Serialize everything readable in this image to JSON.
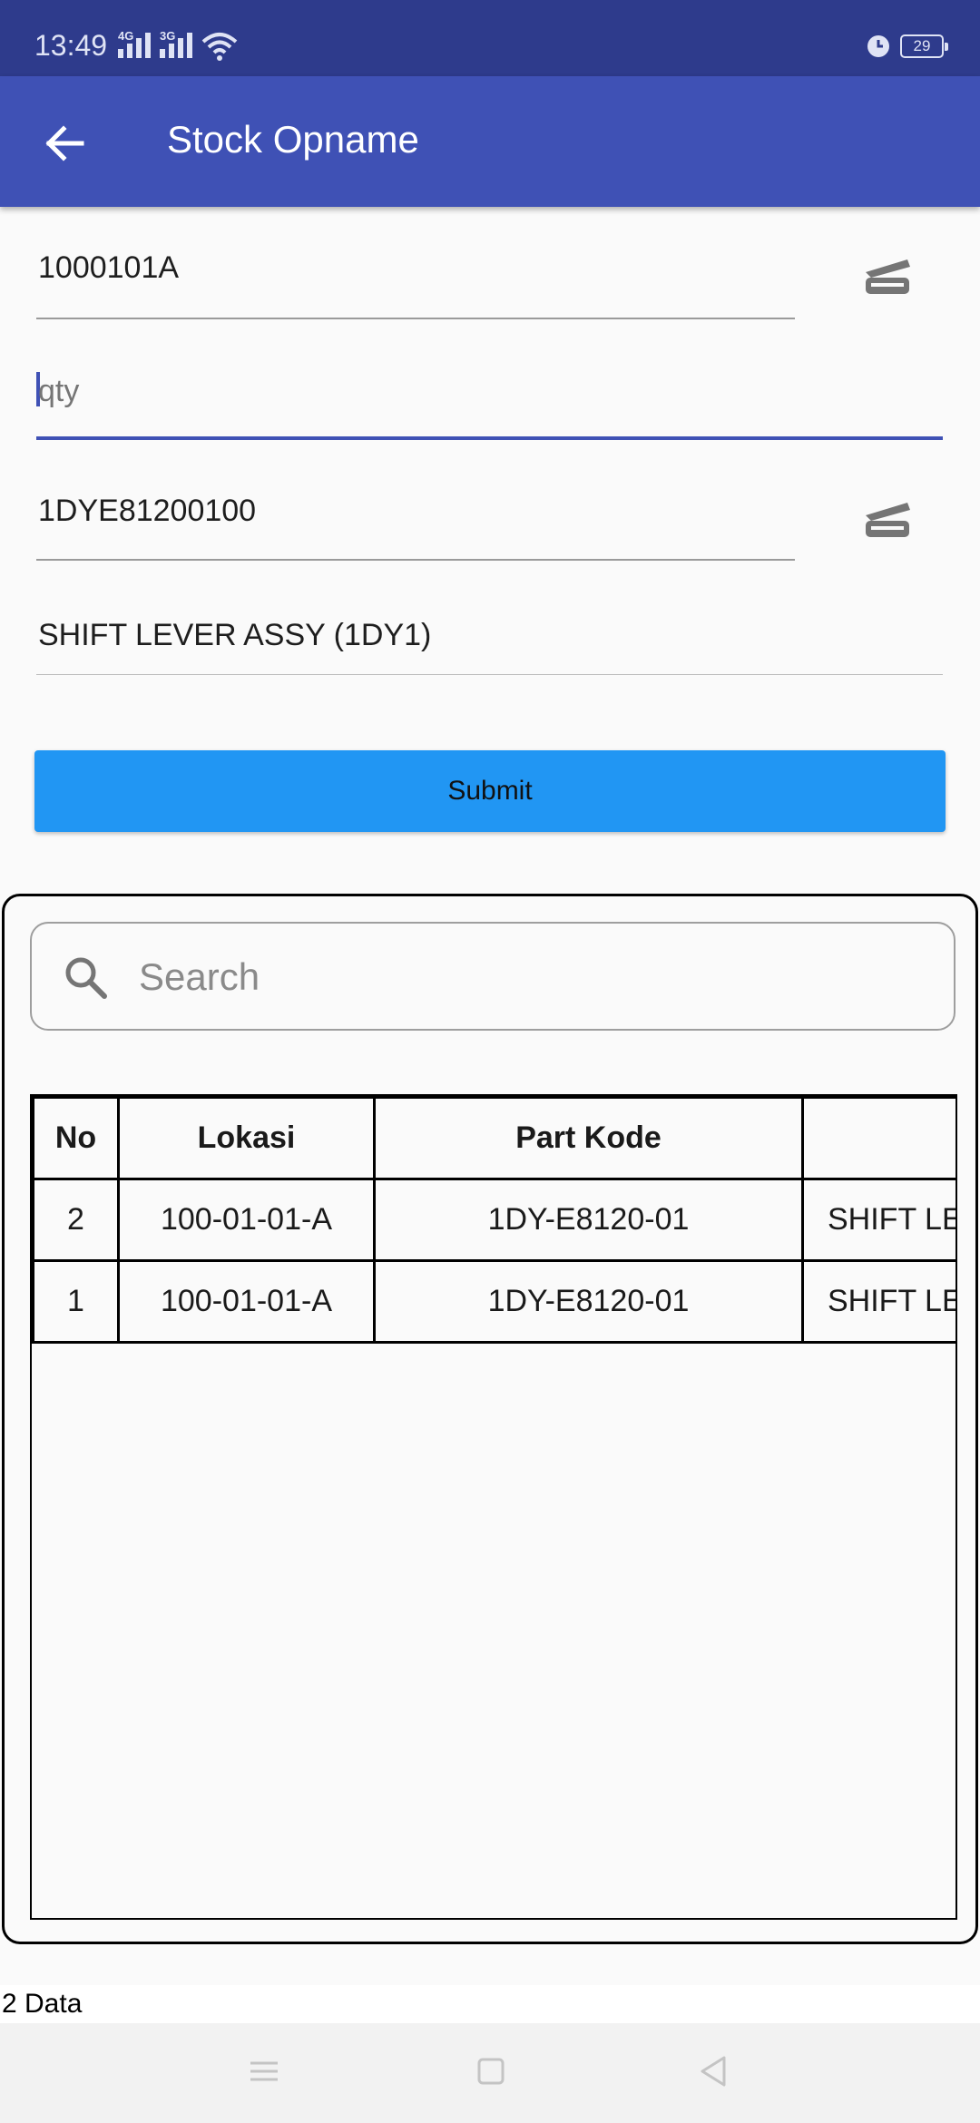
{
  "status_bar": {
    "time": "13:49",
    "network1": "4G",
    "network2": "3G",
    "battery": "29"
  },
  "app_bar": {
    "title": "Stock Opname"
  },
  "form": {
    "location_value": "1000101A",
    "qty_placeholder": "qty",
    "part_value": "1DYE81200100",
    "part_name_value": "SHIFT LEVER ASSY (1DY1)",
    "submit_label": "Submit"
  },
  "search": {
    "placeholder": "Search"
  },
  "table": {
    "headers": [
      "No",
      "Lokasi",
      "Part Kode",
      ""
    ],
    "rows": [
      {
        "no": "2",
        "lokasi": "100-01-01-A",
        "part_kode": "1DY-E8120-01",
        "name": "SHIFT LE"
      },
      {
        "no": "1",
        "lokasi": "100-01-01-A",
        "part_kode": "1DY-E8120-01",
        "name": "SHIFT LE"
      }
    ]
  },
  "footer": {
    "count_text": "2 Data"
  },
  "icons": {
    "back": "arrow-left-icon",
    "scan": "barcode-scanner-icon",
    "search": "search-icon",
    "nav_menu": "menu-icon",
    "nav_home": "home-icon",
    "nav_back": "back-triangle-icon"
  },
  "colors": {
    "status_bar": "#2e3b8c",
    "app_bar": "#3f51b5",
    "submit": "#2196f3",
    "accent": "#3f51b5"
  }
}
